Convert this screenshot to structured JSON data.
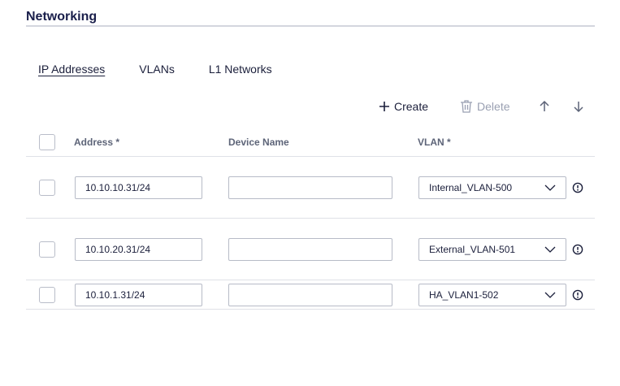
{
  "section": {
    "title": "Networking"
  },
  "tabs": [
    {
      "label": "IP Addresses",
      "active": true
    },
    {
      "label": "VLANs",
      "active": false
    },
    {
      "label": "L1 Networks",
      "active": false
    }
  ],
  "toolbar": {
    "create_label": "Create",
    "delete_label": "Delete",
    "delete_disabled": true,
    "icons": [
      "plus-icon",
      "trash-icon",
      "arrow-up-icon",
      "arrow-down-icon"
    ]
  },
  "table": {
    "columns": {
      "address": "Address *",
      "device_name": "Device Name",
      "vlan": "VLAN *"
    },
    "rows": [
      {
        "address": "10.10.10.31/24",
        "device_name": "",
        "vlan": "Internal_VLAN-500"
      },
      {
        "address": "10.10.20.31/24",
        "device_name": "",
        "vlan": "External_VLAN-501"
      },
      {
        "address": "10.10.1.31/24",
        "device_name": "",
        "vlan": "HA_VLAN1-502"
      }
    ]
  },
  "colors": {
    "title": "#1a1f4b",
    "text": "#1b1f3b",
    "disabled": "#9aa0b2",
    "border": "#b7bbc7",
    "divider": "#dfe1e7"
  }
}
